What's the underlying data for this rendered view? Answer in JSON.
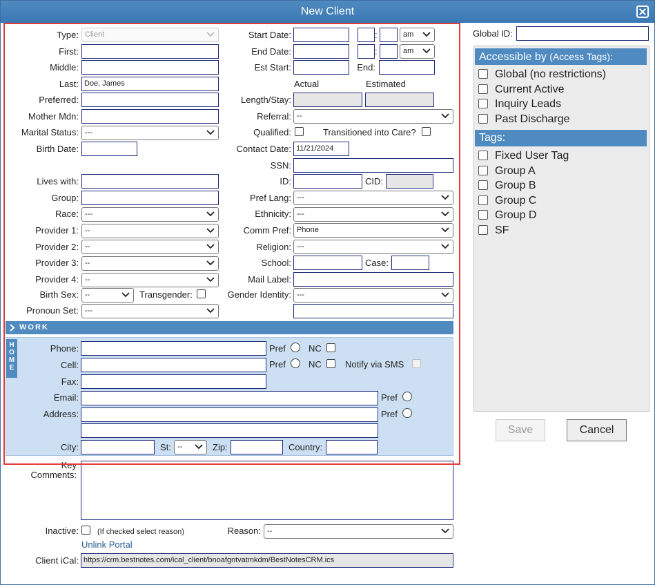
{
  "title": "New Client",
  "form": {
    "type": {
      "label": "Type:",
      "value": "Client"
    },
    "first": {
      "label": "First:",
      "value": ""
    },
    "middle": {
      "label": "Middle:",
      "value": ""
    },
    "last": {
      "label": "Last:",
      "value": "Doe, James"
    },
    "preferred": {
      "label": "Preferred:",
      "value": ""
    },
    "mother_mdn": {
      "label": "Mother Mdn:",
      "value": ""
    },
    "marital_status": {
      "label": "Marital Status:",
      "value": "---"
    },
    "birth_date": {
      "label": "Birth Date:",
      "value": ""
    },
    "lives_with": {
      "label": "Lives with:",
      "value": ""
    },
    "group": {
      "label": "Group:",
      "value": ""
    },
    "race": {
      "label": "Race:",
      "value": "---"
    },
    "provider1": {
      "label": "Provider 1:",
      "value": "--"
    },
    "provider2": {
      "label": "Provider 2:",
      "value": "--"
    },
    "provider3": {
      "label": "Provider 3:",
      "value": "--"
    },
    "provider4": {
      "label": "Provider 4:",
      "value": "--"
    },
    "birth_sex": {
      "label": "Birth Sex:",
      "value": "--"
    },
    "transgender": {
      "label": "Transgender:"
    },
    "pronoun_set": {
      "label": "Pronoun Set:",
      "value": "---"
    },
    "start_date": {
      "label": "Start Date:",
      "ampm": "am"
    },
    "end_date": {
      "label": "End Date:",
      "ampm": "am"
    },
    "est_start": {
      "label": "Est Start:"
    },
    "end": {
      "label": "End:"
    },
    "actual_label": "Actual",
    "estimated_label": "Estimated",
    "length_stay": {
      "label": "Length/Stay:"
    },
    "referral": {
      "label": "Referral:",
      "value": "--"
    },
    "qualified": {
      "label": "Qualified:"
    },
    "transitioned": {
      "label": "Transitioned into Care?"
    },
    "contact_date": {
      "label": "Contact Date:",
      "value": "11/21/2024"
    },
    "ssn": {
      "label": "SSN:"
    },
    "id": {
      "label": "ID:"
    },
    "cid": {
      "label": "CID:"
    },
    "pref_lang": {
      "label": "Pref Lang:",
      "value": "---"
    },
    "ethnicity": {
      "label": "Ethnicity:",
      "value": "---"
    },
    "comm_pref": {
      "label": "Comm Pref:",
      "value": "Phone"
    },
    "religion": {
      "label": "Religion:",
      "value": "---"
    },
    "school": {
      "label": "School:"
    },
    "case": {
      "label": "Case:"
    },
    "mail_label": {
      "label": "Mail Label:"
    },
    "gender_identity": {
      "label": "Gender Identity:",
      "value": "---"
    }
  },
  "work_section": "WORK",
  "home_tab": [
    "H",
    "O",
    "M",
    "E"
  ],
  "contact": {
    "phone": {
      "label": "Phone:"
    },
    "cell": {
      "label": "Cell:"
    },
    "fax": {
      "label": "Fax:"
    },
    "email": {
      "label": "Email:"
    },
    "address": {
      "label": "Address:"
    },
    "city": {
      "label": "City:"
    },
    "st": {
      "label": "St:",
      "value": "--"
    },
    "zip": {
      "label": "Zip:"
    },
    "country": {
      "label": "Country:"
    },
    "pref_label": "Pref",
    "nc_label": "NC",
    "notify_sms": "Notify via SMS"
  },
  "key_comments_label": [
    "Key",
    "Comments:"
  ],
  "inactive": {
    "label": "Inactive:",
    "hint": "(If checked select reason)"
  },
  "reason": {
    "label": "Reason:",
    "value": "--"
  },
  "unlink_portal": "Unlink Portal",
  "ical": {
    "label": "Client iCal:",
    "value": "https://crm.bestnotes.com/ical_client/bnoafgntvatmkdm/BestNotesCRM.ics"
  },
  "global_id": {
    "label": "Global ID:"
  },
  "access": {
    "heading": "Accessible by",
    "heading_sub": "(Access Tags):",
    "items": [
      "Global (no restrictions)",
      "Current Active",
      "Inquiry Leads",
      "Past Discharge"
    ]
  },
  "tags": {
    "heading": "Tags:",
    "items": [
      "Fixed User Tag",
      "Group A",
      "Group B",
      "Group C",
      "Group D",
      "SF"
    ]
  },
  "buttons": {
    "save": "Save",
    "cancel": "Cancel"
  }
}
